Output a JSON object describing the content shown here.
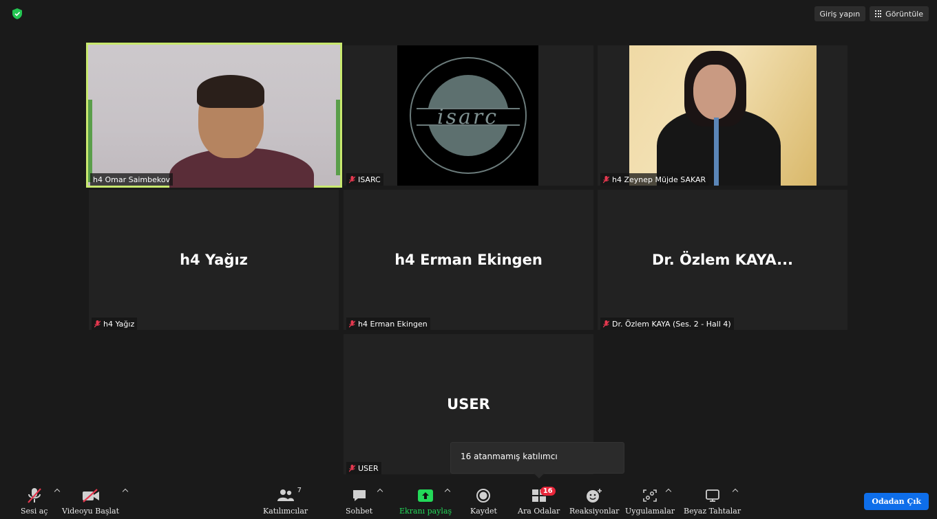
{
  "topbar": {
    "signin": "Giriş yapın",
    "view": "Görüntüle"
  },
  "tiles": [
    {
      "name": "h4 Omar Saimbekov",
      "big": "",
      "muted": false
    },
    {
      "name": "ISARC",
      "big": "",
      "muted": true
    },
    {
      "name": "h4 Zeynep Müjde SAKAR",
      "big": "",
      "muted": true
    },
    {
      "name": "h4 Yağız",
      "big": "h4 Yağız",
      "muted": true
    },
    {
      "name": "h4 Erman Ekingen",
      "big": "h4 Erman Ekingen",
      "muted": true
    },
    {
      "name": "Dr. Özlem KAYA (Ses. 2 - Hall 4)",
      "big": "Dr. Özlem KAYA...",
      "muted": true
    },
    {
      "name": "USER",
      "big": "USER",
      "muted": true
    }
  ],
  "logo": {
    "text": "isarc"
  },
  "popup": {
    "text": "16 atanmamış katılımcı"
  },
  "toolbar": {
    "unmute": "Sesi aç",
    "start_video": "Videoyu Başlat",
    "participants": "Katılımcılar",
    "participants_count": "7",
    "chat": "Sohbet",
    "share": "Ekranı paylaş",
    "record": "Kaydet",
    "breakout": "Ara Odalar",
    "breakout_badge": "16",
    "reactions": "Reaksiyonlar",
    "apps": "Uygulamalar",
    "whiteboards": "Beyaz Tahtalar",
    "leave": "Odadan Çık"
  },
  "colors": {
    "accent_active": "#c8e86e",
    "share_green": "#23d959",
    "leave_blue": "#0e6eea",
    "badge_red": "#e8263a",
    "muted_red": "#e5384f"
  }
}
